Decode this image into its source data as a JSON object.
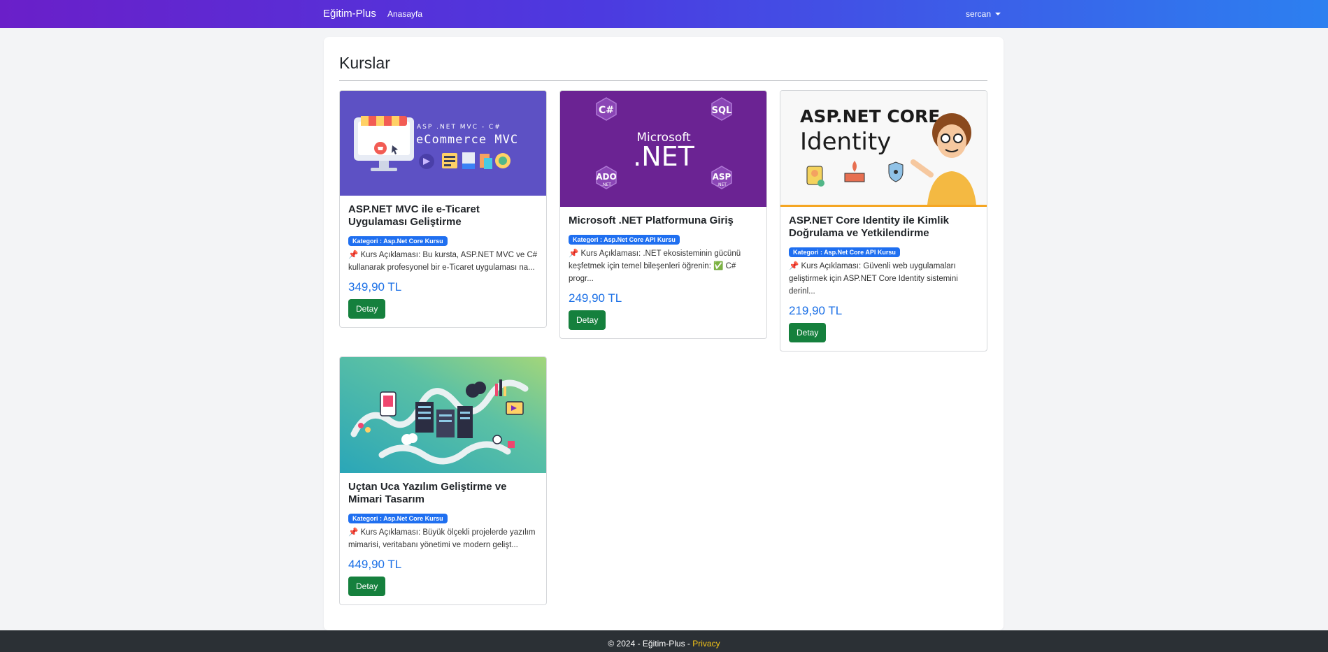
{
  "navbar": {
    "brand": "Eğitim-Plus",
    "home_link": "Anasayfa",
    "user_name": "sercan"
  },
  "main": {
    "title": "Kurslar"
  },
  "courses": [
    {
      "thumb_text_small": "ASP .NET MVC - C#",
      "thumb_text_big": "eCommerce MVC",
      "title": "ASP.NET MVC ile e-Ticaret Uygulaması Geliştirme",
      "category": "Kategori : Asp.Net Core Kursu",
      "description": "📌 Kurs Açıklaması: Bu kursta, ASP.NET MVC ve C# kullanarak profesyonel bir e-Ticaret uygulaması na...",
      "price": "349,90 TL",
      "button": "Detay"
    },
    {
      "thumb_text_small": "Microsoft",
      "thumb_text_big": ".NET",
      "thumb_hex": [
        "C#",
        "SQL",
        "ADO",
        "ASP"
      ],
      "thumb_hex_sub": ".NET",
      "title": "Microsoft .NET Platformuna Giriş",
      "category": "Kategori : Asp.Net Core API Kursu",
      "description": "📌 Kurs Açıklaması: .NET ekosisteminin gücünü keşfetmek için temel bileşenleri öğrenin: ✅ C# progr...",
      "price": "249,90 TL",
      "button": "Detay"
    },
    {
      "thumb_text_small": "ASP.NET CORE",
      "thumb_text_big": "Identity",
      "title": "ASP.NET Core Identity ile Kimlik Doğrulama ve Yetkilendirme",
      "category": "Kategori : Asp.Net Core API Kursu",
      "description": "📌 Kurs Açıklaması: Güvenli web uygulamaları geliştirmek için ASP.NET Core Identity sistemini derinl...",
      "price": "219,90 TL",
      "button": "Detay"
    },
    {
      "title": "Uçtan Uca Yazılım Geliştirme ve Mimari Tasarım",
      "category": "Kategori : Asp.Net Core Kursu",
      "description": "📌 Kurs Açıklaması: Büyük ölçekli projelerde yazılım mimarisi, veritabanı yönetimi ve modern gelişt...",
      "price": "449,90 TL",
      "button": "Detay"
    }
  ],
  "footer": {
    "text": "© 2024 - Eğitim-Plus - ",
    "privacy": "Privacy"
  },
  "colors": {
    "nav_start": "#6a1fc9",
    "nav_end": "#2c80f0",
    "price": "#1a6fe6",
    "button": "#15803d",
    "badge": "#1f6ff0",
    "footer": "#2b3035",
    "footer_link": "#f5c518"
  }
}
